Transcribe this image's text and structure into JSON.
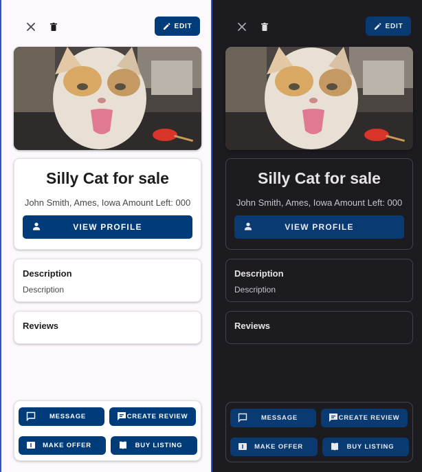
{
  "toolbar": {
    "close_icon": "close-icon",
    "delete_icon": "delete-icon",
    "edit_label": "EDIT"
  },
  "listing": {
    "title": "Silly Cat for sale",
    "subtitle": "John Smith, Ames, Iowa Amount Left: 000",
    "view_profile_label": "VIEW PROFILE"
  },
  "description": {
    "heading": "Description",
    "body": "Description"
  },
  "reviews": {
    "heading": "Reviews"
  },
  "actions": {
    "message": "MESSAGE",
    "create_review": "CREATE REVIEW",
    "make_offer": "MAKE OFFER",
    "buy_listing": "BUY LISTING"
  },
  "colors": {
    "primary_light": "#003b7a",
    "primary_dark": "#0a3a72",
    "light_bg": "#fcf8fd",
    "dark_bg": "#1c1b1f",
    "panel_divider": "#2f56c6"
  }
}
